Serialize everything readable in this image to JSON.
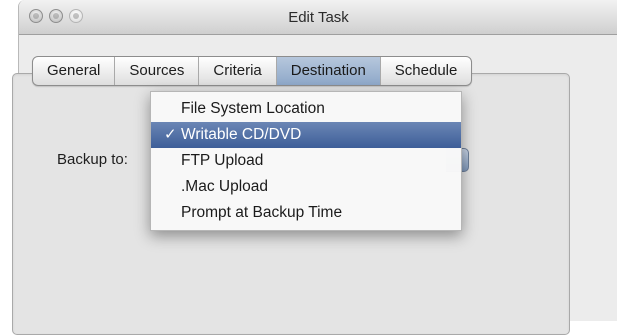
{
  "window": {
    "title": "Edit Task"
  },
  "tabs": [
    {
      "label": "General",
      "selected": false
    },
    {
      "label": "Sources",
      "selected": false
    },
    {
      "label": "Criteria",
      "selected": false
    },
    {
      "label": "Destination",
      "selected": true
    },
    {
      "label": "Schedule",
      "selected": false
    }
  ],
  "backup": {
    "label": "Backup to:",
    "selected_value": "Writable CD/DVD",
    "options": [
      {
        "label": "File System Location"
      },
      {
        "label": "Writable CD/DVD",
        "selected": true,
        "check": "✓"
      },
      {
        "label": "FTP Upload"
      },
      {
        "label": ".Mac Upload"
      },
      {
        "label": "Prompt at Backup Time"
      }
    ]
  },
  "colors": {
    "selection": "#4a6aa4",
    "tab_selected": "#9fb5d2",
    "window_bg": "#ececec"
  }
}
